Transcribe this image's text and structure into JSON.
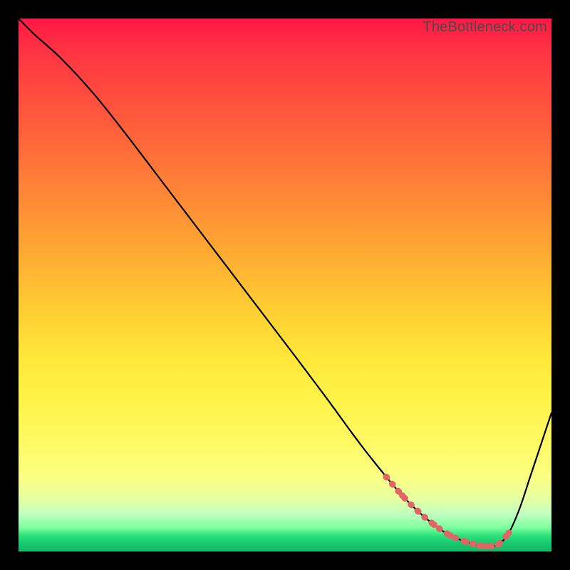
{
  "watermark": "TheBottleneck.com",
  "chart_data": {
    "type": "line",
    "title": "",
    "xlabel": "",
    "ylabel": "",
    "xlim": [
      0,
      100
    ],
    "ylim": [
      0,
      100
    ],
    "series": [
      {
        "name": "bottleneck-curve",
        "x": [
          0,
          3,
          8,
          14,
          20,
          28,
          36,
          44,
          52,
          58,
          62,
          65,
          69,
          72,
          75,
          78,
          81,
          84,
          86.5,
          88,
          90,
          92,
          94,
          96,
          98,
          100
        ],
        "y": [
          100,
          97,
          92.5,
          86,
          78.5,
          68,
          57.5,
          47,
          36.5,
          28.5,
          23,
          19,
          14,
          10.5,
          7.5,
          5,
          3,
          1.8,
          1.1,
          1,
          1.3,
          3.5,
          8,
          14,
          20,
          26
        ]
      }
    ],
    "highlight_segment": {
      "x": [
        69,
        72,
        75,
        78,
        81,
        84,
        86.5,
        88,
        90,
        92
      ],
      "y": [
        14,
        10.5,
        7.5,
        5,
        3,
        1.8,
        1.1,
        1,
        1.3,
        3.5
      ]
    },
    "colors": {
      "curve": "#000000",
      "highlight": "#e06666"
    }
  }
}
